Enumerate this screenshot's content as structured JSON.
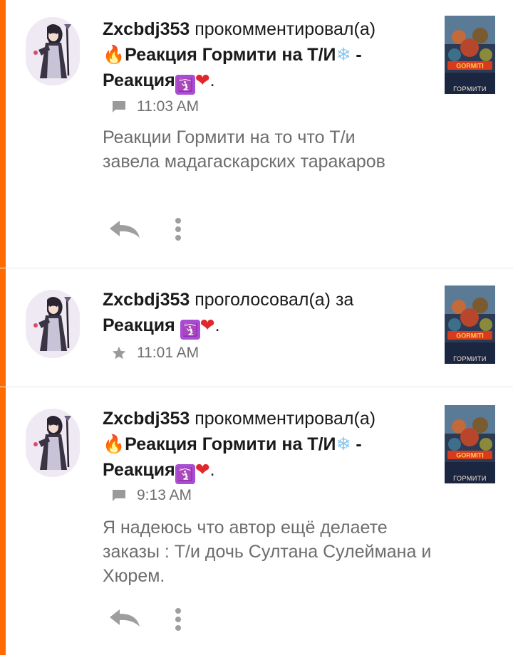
{
  "accent_color": "#ff6b00",
  "notifications": [
    {
      "user": "Zxcbdj353",
      "action": "прокомментировал(а)",
      "story_line1": "Реакция Гормити на Т/И",
      "story_line2": "Реакция",
      "time": "11:03 AM",
      "type_icon": "comment-icon",
      "comment": "Реакции Гормити на то что Т/и завела мадагаскарских таракаров",
      "cover_text": "ГОРМИТИ"
    },
    {
      "user": "Zxcbdj353",
      "action": "проголосовал(а) за",
      "story_line1": "Реакция",
      "time": "11:01 AM",
      "type_icon": "star-icon",
      "cover_text": "ГОРМИТИ"
    },
    {
      "user": "Zxcbdj353",
      "action": "прокомментировал(а)",
      "story_line1": "Реакция Гормити на Т/И",
      "story_line2": "Реакция",
      "time": "9:13 AM",
      "type_icon": "comment-icon",
      "comment": "Я надеюсь что автор ещё делаете заказы : Т/и дочь Султана Сулеймана и Хюрем.",
      "cover_text": "ГОРМИТИ"
    }
  ]
}
